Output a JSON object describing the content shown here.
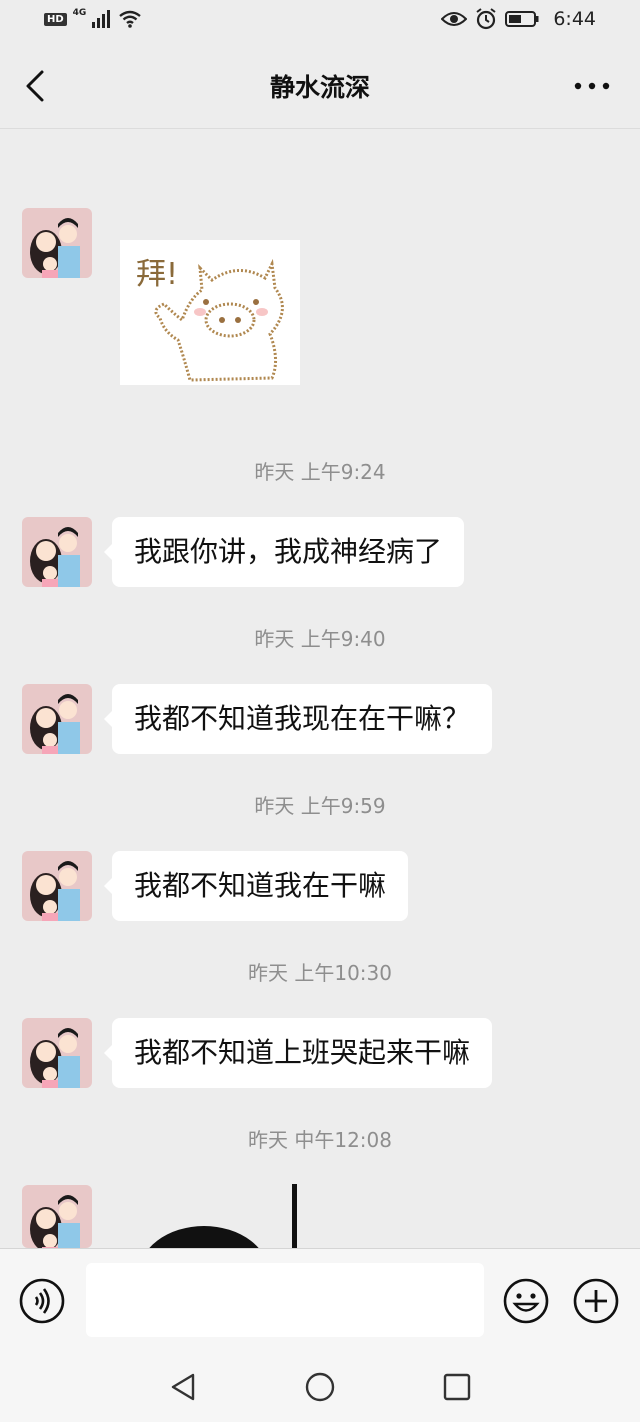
{
  "status_bar": {
    "hd": "HD",
    "network": "4G",
    "time": "6:44"
  },
  "header": {
    "title": "静水流深"
  },
  "messages": [
    {
      "type": "sticker",
      "sticker_text": "拜!"
    },
    {
      "type": "timestamp",
      "text": "昨天 上午9:24"
    },
    {
      "type": "text",
      "text": "我跟你讲，我成神经病了"
    },
    {
      "type": "timestamp",
      "text": "昨天 上午9:40"
    },
    {
      "type": "text",
      "text": "我都不知道我现在在干嘛？"
    },
    {
      "type": "timestamp",
      "text": "昨天 上午9:59"
    },
    {
      "type": "text",
      "text": "我都不知道我在干嘛"
    },
    {
      "type": "timestamp",
      "text": "昨天 上午10:30"
    },
    {
      "type": "text",
      "text": "我都不知道上班哭起来干嘛"
    },
    {
      "type": "timestamp",
      "text": "昨天 中午12:08"
    },
    {
      "type": "sticker",
      "sticker_text": ""
    }
  ],
  "input_bar": {
    "voice_icon": "voice-icon",
    "emoji_icon": "emoji-icon",
    "plus_icon": "plus-icon",
    "text_value": ""
  },
  "nav_bar": {
    "back_icon": "triangle-back-icon",
    "home_icon": "circle-home-icon",
    "recent_icon": "square-recent-icon"
  },
  "colors": {
    "background": "#ededed",
    "bubble": "#ffffff",
    "timestamp": "#8e8e8e"
  }
}
